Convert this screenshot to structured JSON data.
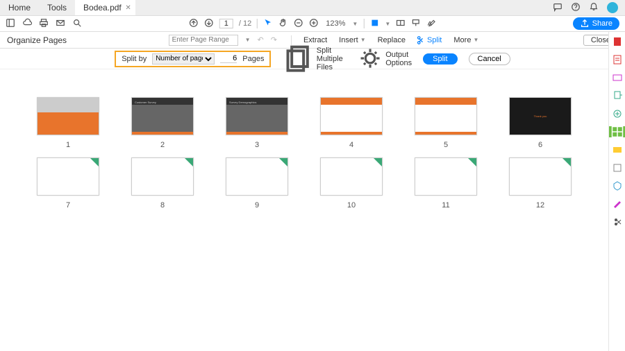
{
  "tabs": {
    "home": "Home",
    "tools": "Tools",
    "doc": "Bodea.pdf"
  },
  "share": "Share",
  "page": {
    "current": "1",
    "total": "/ 12"
  },
  "zoom": "123%",
  "mode": {
    "title": "Organize Pages",
    "range_ph": "Enter Page Range",
    "close": "Close"
  },
  "tools": {
    "extract": "Extract",
    "insert": "Insert",
    "replace": "Replace",
    "split": "Split",
    "more": "More"
  },
  "splitbar": {
    "label": "Split by",
    "method": "Number of pages",
    "value": "6",
    "unit": "Pages",
    "multi": "Split Multiple Files",
    "options": "Output Options",
    "split": "Split",
    "cancel": "Cancel"
  },
  "pages": [
    "1",
    "2",
    "3",
    "4",
    "5",
    "6",
    "7",
    "8",
    "9",
    "10",
    "11",
    "12"
  ]
}
